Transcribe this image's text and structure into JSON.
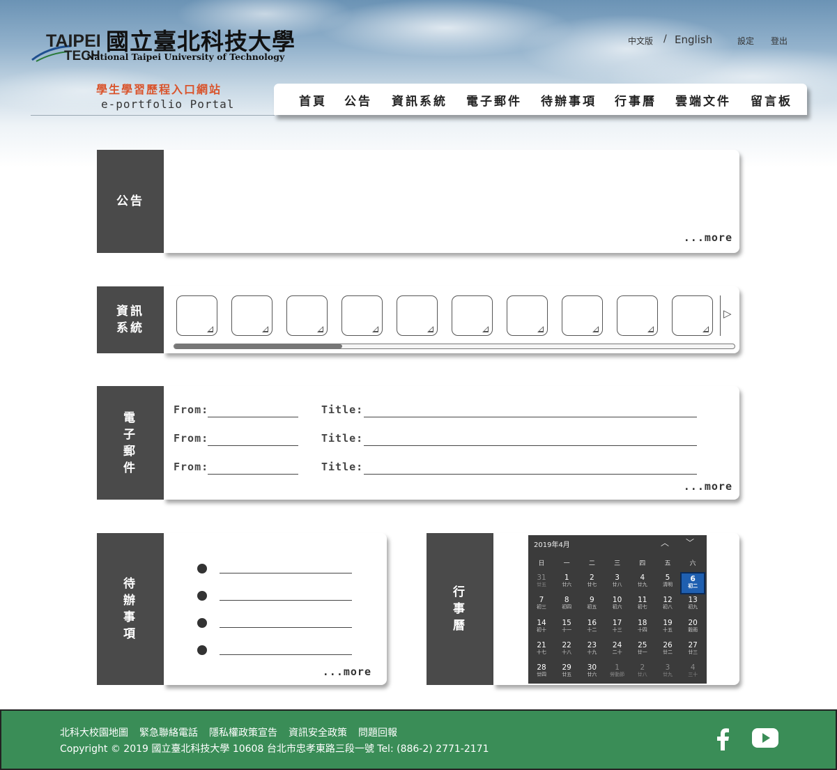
{
  "header": {
    "logo_taipei": "TAIPEI",
    "logo_tech": "TECH",
    "logo_name_cn": "國立臺北科技大學",
    "logo_name_en": "National Taipei University of Technology",
    "portal_cn": "學生學習歷程入口網站",
    "portal_en": "e-portfolio Portal",
    "lang_zh": "中文版",
    "lang_sep": "/",
    "lang_en": "English",
    "settings": "設定",
    "logout": "登出"
  },
  "nav": {
    "items": [
      "首頁",
      "公告",
      "資訊系統",
      "電子郵件",
      "待辦事項",
      "行事曆",
      "雲端文件",
      "留言板"
    ]
  },
  "announcements": {
    "label": "公告",
    "more": "...more"
  },
  "info_systems": {
    "label_line1": "資訊",
    "label_line2": "系統",
    "next_arrow": "▷",
    "scroll_position": 0.3
  },
  "email": {
    "label": [
      "電",
      "子",
      "郵",
      "件"
    ],
    "from_label": "From:",
    "title_label": "Title:",
    "more": "...more"
  },
  "todo": {
    "label": [
      "待",
      "辦",
      "事",
      "項"
    ],
    "more": "...more"
  },
  "calendar": {
    "label": [
      "行",
      "事",
      "曆"
    ],
    "month_title": "2019年4月",
    "up_arrow": "︿",
    "down_arrow": "﹀",
    "weekdays": [
      "日",
      "一",
      "二",
      "三",
      "四",
      "五",
      "六"
    ],
    "days": [
      {
        "d": "31",
        "l": "廿五",
        "muted": true
      },
      {
        "d": "1",
        "l": "廿六"
      },
      {
        "d": "2",
        "l": "廿七"
      },
      {
        "d": "3",
        "l": "廿八"
      },
      {
        "d": "4",
        "l": "廿九"
      },
      {
        "d": "5",
        "l": "清明"
      },
      {
        "d": "6",
        "l": "初二",
        "today": true
      },
      {
        "d": "7",
        "l": "初三"
      },
      {
        "d": "8",
        "l": "初四"
      },
      {
        "d": "9",
        "l": "初五"
      },
      {
        "d": "10",
        "l": "初六"
      },
      {
        "d": "11",
        "l": "初七"
      },
      {
        "d": "12",
        "l": "初八"
      },
      {
        "d": "13",
        "l": "初九"
      },
      {
        "d": "14",
        "l": "初十"
      },
      {
        "d": "15",
        "l": "十一"
      },
      {
        "d": "16",
        "l": "十二"
      },
      {
        "d": "17",
        "l": "十三"
      },
      {
        "d": "18",
        "l": "十四"
      },
      {
        "d": "19",
        "l": "十五"
      },
      {
        "d": "20",
        "l": "穀雨"
      },
      {
        "d": "21",
        "l": "十七"
      },
      {
        "d": "22",
        "l": "十八"
      },
      {
        "d": "23",
        "l": "十九"
      },
      {
        "d": "24",
        "l": "二十"
      },
      {
        "d": "25",
        "l": "廿一"
      },
      {
        "d": "26",
        "l": "廿二"
      },
      {
        "d": "27",
        "l": "廿三"
      },
      {
        "d": "28",
        "l": "廿四"
      },
      {
        "d": "29",
        "l": "廿五"
      },
      {
        "d": "30",
        "l": "廿六"
      },
      {
        "d": "1",
        "l": "勞動節",
        "muted": true
      },
      {
        "d": "2",
        "l": "廿八",
        "muted": true
      },
      {
        "d": "3",
        "l": "廿九",
        "muted": true
      },
      {
        "d": "4",
        "l": "三十",
        "muted": true
      }
    ]
  },
  "footer": {
    "links": [
      "北科大校園地圖",
      "緊急聯絡電話",
      "隱私權政策宣告",
      "資訊安全政策",
      "問題回報"
    ],
    "copyright": "Copyright © 2019 國立臺北科技大學 10608 台北市忠孝東路三段一號 Tel: (886-2) 2771-2171",
    "colors": {
      "background": "#3a8d57",
      "text": "#ffffff"
    }
  }
}
